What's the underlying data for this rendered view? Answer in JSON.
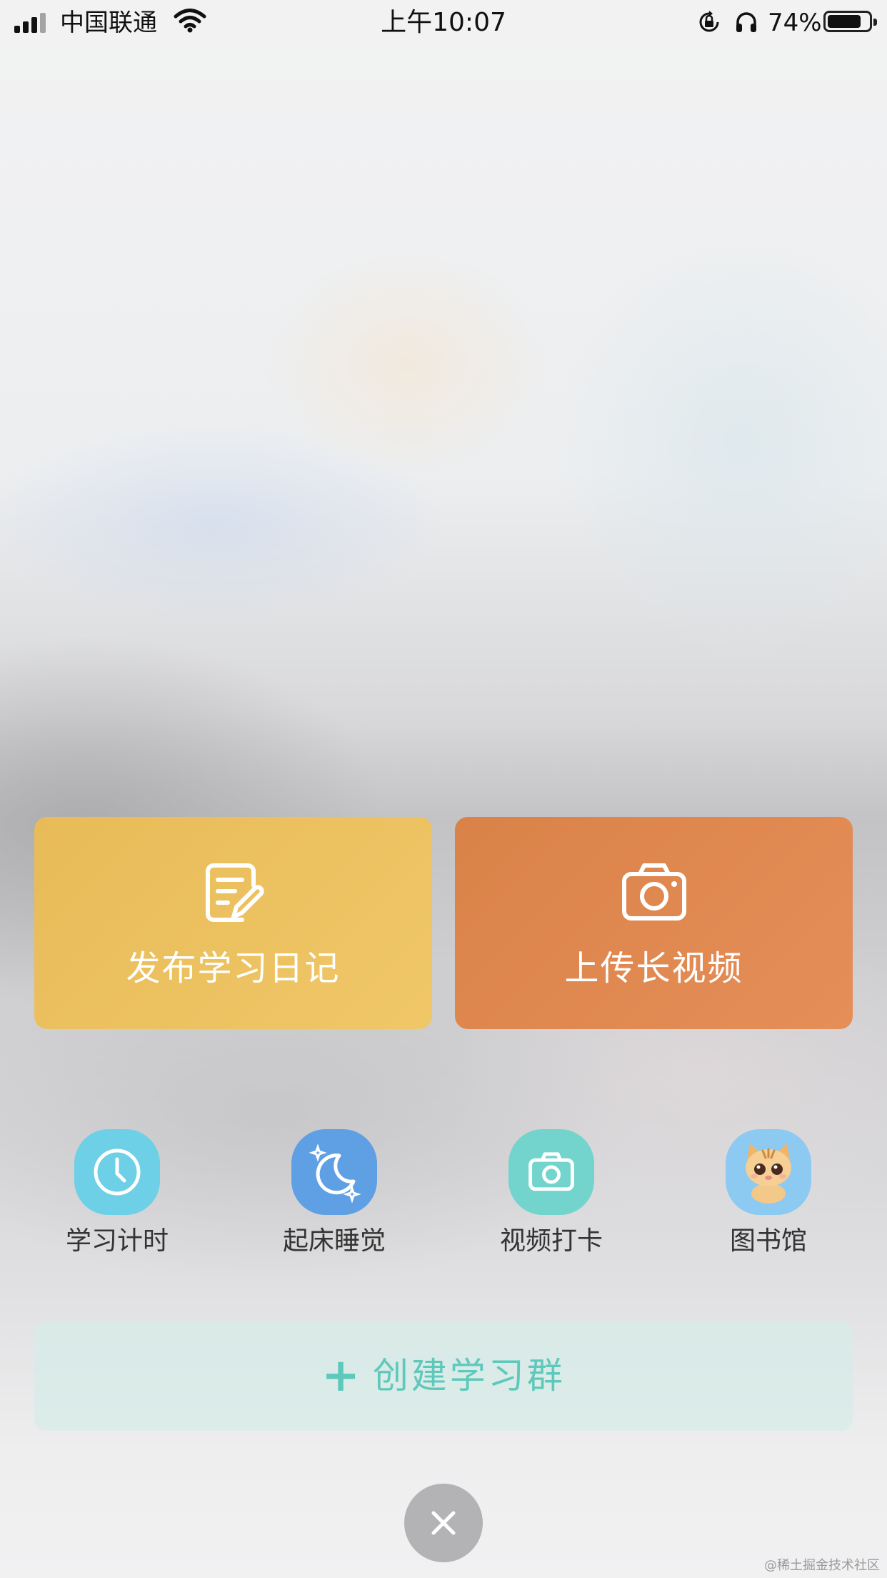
{
  "status_bar": {
    "carrier": "中国联通",
    "time": "上午10:07",
    "battery_percent": "74%",
    "battery_level": 0.74
  },
  "cards": {
    "diary": {
      "label": "发布学习日记",
      "icon": "edit-note-icon",
      "color": "#ebbf5f"
    },
    "video": {
      "label": "上传长视频",
      "icon": "camera-icon",
      "color": "#df8850"
    }
  },
  "quick_actions": [
    {
      "label": "学习计时",
      "icon": "clock-icon",
      "color": "#6dd0e6"
    },
    {
      "label": "起床睡觉",
      "icon": "moon-stars-icon",
      "color": "#5f9fe4"
    },
    {
      "label": "视频打卡",
      "icon": "camera-icon",
      "color": "#72d4cc"
    },
    {
      "label": "图书馆",
      "icon": "cat-avatar-icon",
      "color": "#8ccaf2"
    }
  ],
  "create_group": {
    "plus": "+",
    "label": "创建学习群",
    "color": "#5ec9bb"
  },
  "close_button": {
    "icon": "close-icon"
  },
  "watermark": "@稀土掘金技术社区"
}
